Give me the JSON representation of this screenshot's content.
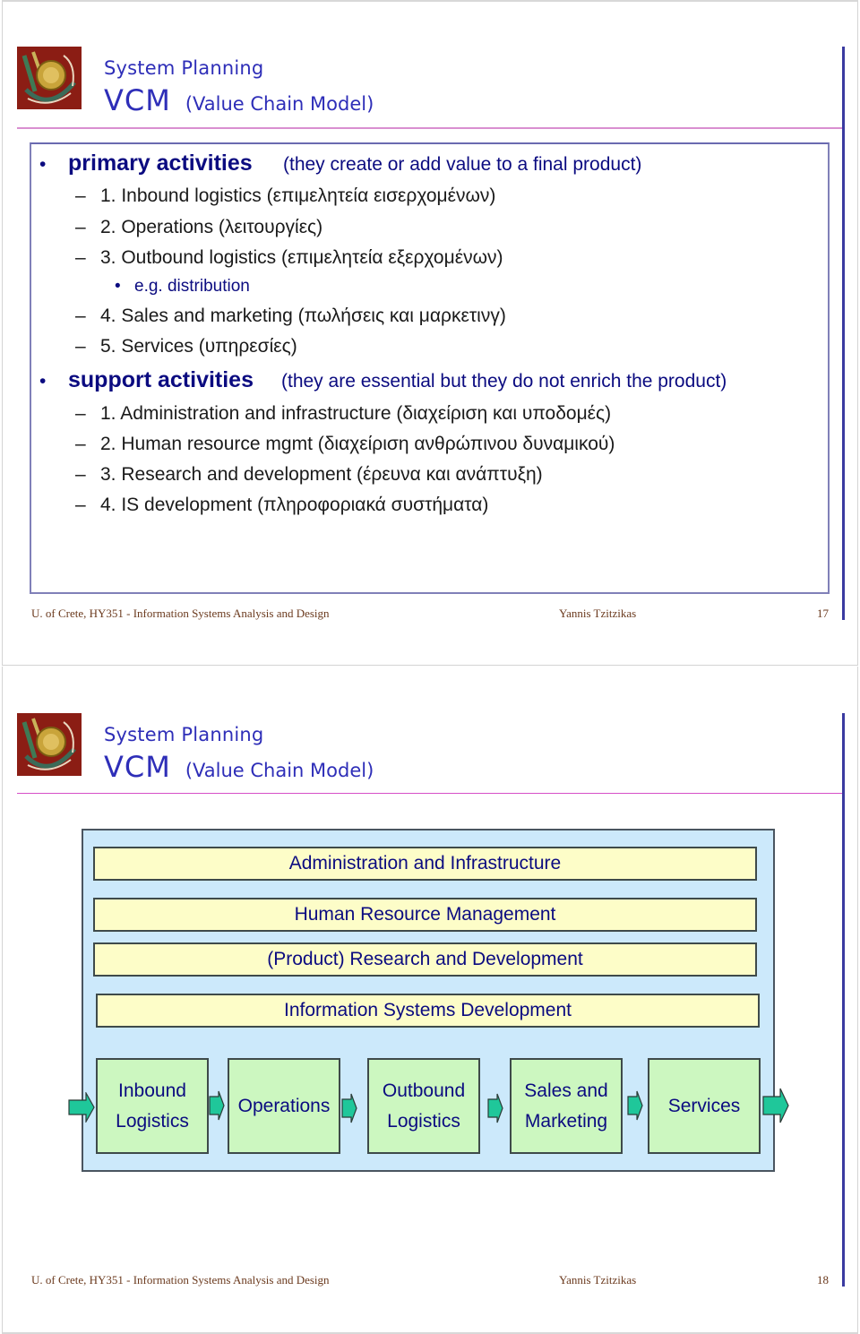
{
  "slides": [
    {
      "header": {
        "logo_label": "University of Crete logo",
        "title_line1": "System Planning",
        "title_vcm": "VCM",
        "title_sub": "(Value Chain Model)"
      },
      "sections": [
        {
          "heading": "primary activities",
          "note": " (they create or add value to a final product)",
          "items": [
            {
              "marker": "–",
              "text": "1. Inbound logistics (επιμελητεία εισερχομένων)"
            },
            {
              "marker": "–",
              "text": "2. Operations (λειτουργίες)"
            },
            {
              "marker": "–",
              "text": "3. Outbound logistics (επιμελητεία εξερχομένων)"
            },
            {
              "marker": "•",
              "text": "e.g. distribution",
              "sub": true
            },
            {
              "marker": "–",
              "text": "4. Sales and marketing (πωλήσεις και μαρκετινγ)"
            },
            {
              "marker": "–",
              "text": "5. Services (υπηρεσίες)"
            }
          ]
        },
        {
          "heading": "support activities",
          "note": " (they are essential but they do not enrich the product)",
          "items": [
            {
              "marker": "–",
              "text": "1. Administration and infrastructure (διαχείριση και υποδομές)"
            },
            {
              "marker": "–",
              "text": "2. Human resource mgmt (διαχείριση ανθρώπινου δυναμικού)"
            },
            {
              "marker": "–",
              "text": "3. Research and development (έρευνα και ανάπτυξη)"
            },
            {
              "marker": "–",
              "text": "4. IS development  (πληροφοριακά συστήματα)"
            }
          ]
        }
      ],
      "footer": {
        "course": "U. of Crete,  HY351 - Information Systems Analysis and Design",
        "author": "Yannis Tzitzikas",
        "page": "17"
      }
    },
    {
      "header": {
        "logo_label": "University of Crete logo",
        "title_line1": "System Planning",
        "title_vcm": "VCM",
        "title_sub": "(Value Chain Model)"
      },
      "diagram": {
        "support_activities": [
          "Administration and Infrastructure",
          "Human Resource Management",
          "(Product) Research and Development",
          "Information Systems Development"
        ],
        "primary_activities": [
          {
            "line1": "Inbound",
            "line2": "Logistics"
          },
          {
            "line1": "Operations",
            "line2": ""
          },
          {
            "line1": "Outbound",
            "line2": "Logistics"
          },
          {
            "line1": "Sales and",
            "line2": "Marketing"
          },
          {
            "line1": "Services",
            "line2": ""
          }
        ],
        "colors": {
          "frame": "#cce9fb",
          "support_bar": "#fdfdc8",
          "primary_box": "#ccf7c0",
          "arrow": "#1fc79a",
          "text": "#0b0b80"
        }
      },
      "footer": {
        "course": "U. of Crete,  HY351 - Information Systems Analysis and Design",
        "author": "Yannis Tzitzikas",
        "page": "18"
      }
    }
  ],
  "theme": {
    "title_color": "#2e2eb8",
    "rule_color": "#d98fd0",
    "footer_color": "#6b3a1e"
  }
}
